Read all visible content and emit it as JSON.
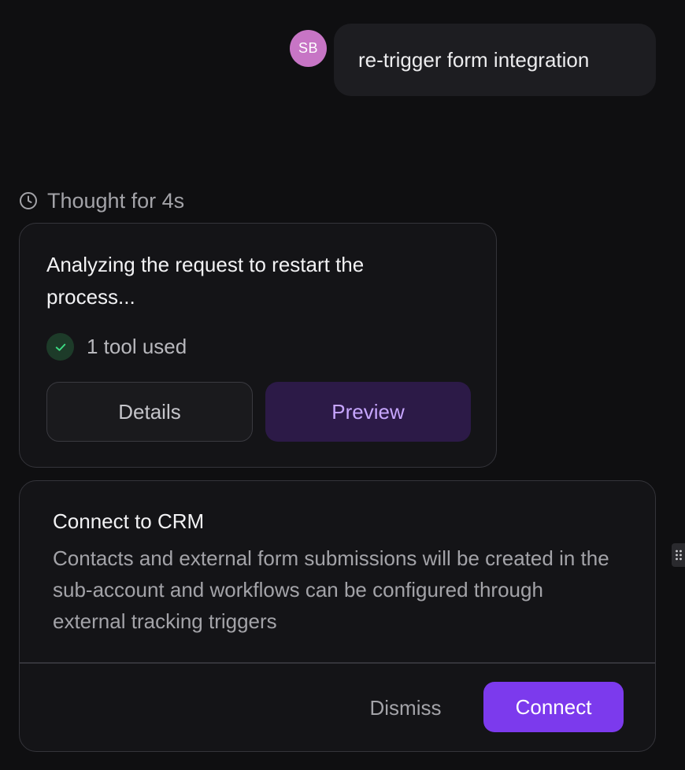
{
  "user_message": {
    "avatar_initials": "SB",
    "avatar_color": "#c775c5",
    "text": "re-trigger form integration"
  },
  "thought": {
    "icon": "clock-icon",
    "label": "Thought for 4s"
  },
  "analysis_card": {
    "text": "Analyzing the request to restart the process...",
    "tools_icon": "check-circle-icon",
    "tools_label": "1 tool used",
    "details_label": "Details",
    "preview_label": "Preview"
  },
  "crm_card": {
    "title": "Connect to CRM",
    "description": "Contacts and external form submissions will be created in the sub-account and workflows can be configured through external tracking triggers",
    "dismiss_label": "Dismiss",
    "connect_label": "Connect",
    "accent_color": "#7c3aed"
  },
  "side_handle": {
    "icon": "grip-dots-icon"
  }
}
